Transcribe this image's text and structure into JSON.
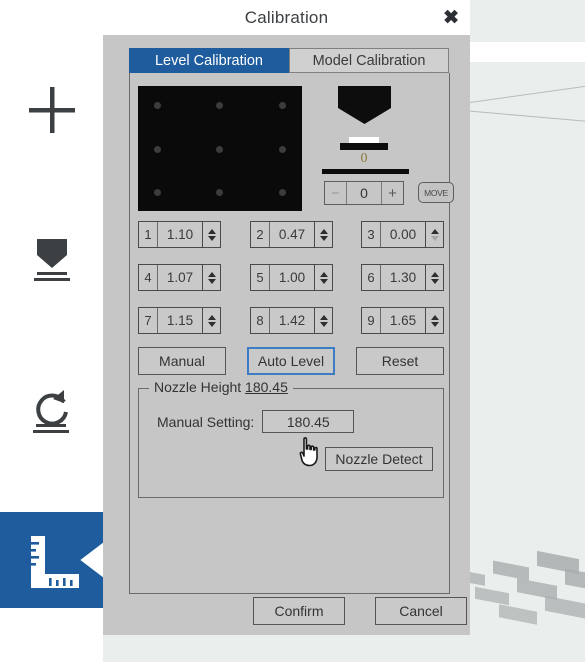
{
  "window": {
    "title": "Calibration",
    "close_label": "✖"
  },
  "toolbar": {
    "items": [
      {
        "icon": "plus-icon",
        "selected": false
      },
      {
        "icon": "nozzle-icon",
        "selected": false
      },
      {
        "icon": "rotate-reset-icon",
        "selected": false
      },
      {
        "icon": "ruler-calibration-icon",
        "selected": true
      }
    ]
  },
  "tabs": [
    {
      "label": "Level Calibration",
      "active": true
    },
    {
      "label": "Model Calibration",
      "active": false
    }
  ],
  "bed_preview": {
    "rows": 3,
    "columns": 3,
    "background_color": "#0a0a0a",
    "dot_color": "#3c3c3c"
  },
  "nozzle_indicator": {
    "offset_value": "0",
    "offset_color": "#8b7b3c"
  },
  "stepper": {
    "minus_label": "−",
    "value": "0",
    "plus_label": "+",
    "minus_enabled": false,
    "move_label": "MOVE"
  },
  "mesh": {
    "points": [
      {
        "index": "1",
        "value": "1.10",
        "down_enabled": true
      },
      {
        "index": "2",
        "value": "0.47",
        "down_enabled": true
      },
      {
        "index": "3",
        "value": "0.00",
        "down_enabled": false
      },
      {
        "index": "4",
        "value": "1.07",
        "down_enabled": true
      },
      {
        "index": "5",
        "value": "1.00",
        "down_enabled": true
      },
      {
        "index": "6",
        "value": "1.30",
        "down_enabled": true
      },
      {
        "index": "7",
        "value": "1.15",
        "down_enabled": true
      },
      {
        "index": "8",
        "value": "1.42",
        "down_enabled": true
      },
      {
        "index": "9",
        "value": "1.65",
        "down_enabled": true
      }
    ]
  },
  "actions": {
    "manual_label": "Manual",
    "auto_level_label": "Auto Level",
    "reset_label": "Reset",
    "focused": "auto-level"
  },
  "nozzle_height": {
    "legend_prefix": "Nozzle Height ",
    "legend_value": "180.45",
    "manual_setting_label": "Manual Setting:",
    "manual_setting_value": "180.45",
    "detect_label": "Nozzle Detect"
  },
  "footer": {
    "confirm_label": "Confirm",
    "cancel_label": "Cancel"
  },
  "colors": {
    "accent_blue": "#1e5c9e",
    "focus_blue": "#3c7cc4",
    "dialog_grey": "#c6c6c6",
    "viewport_bg": "#eaeeed"
  }
}
